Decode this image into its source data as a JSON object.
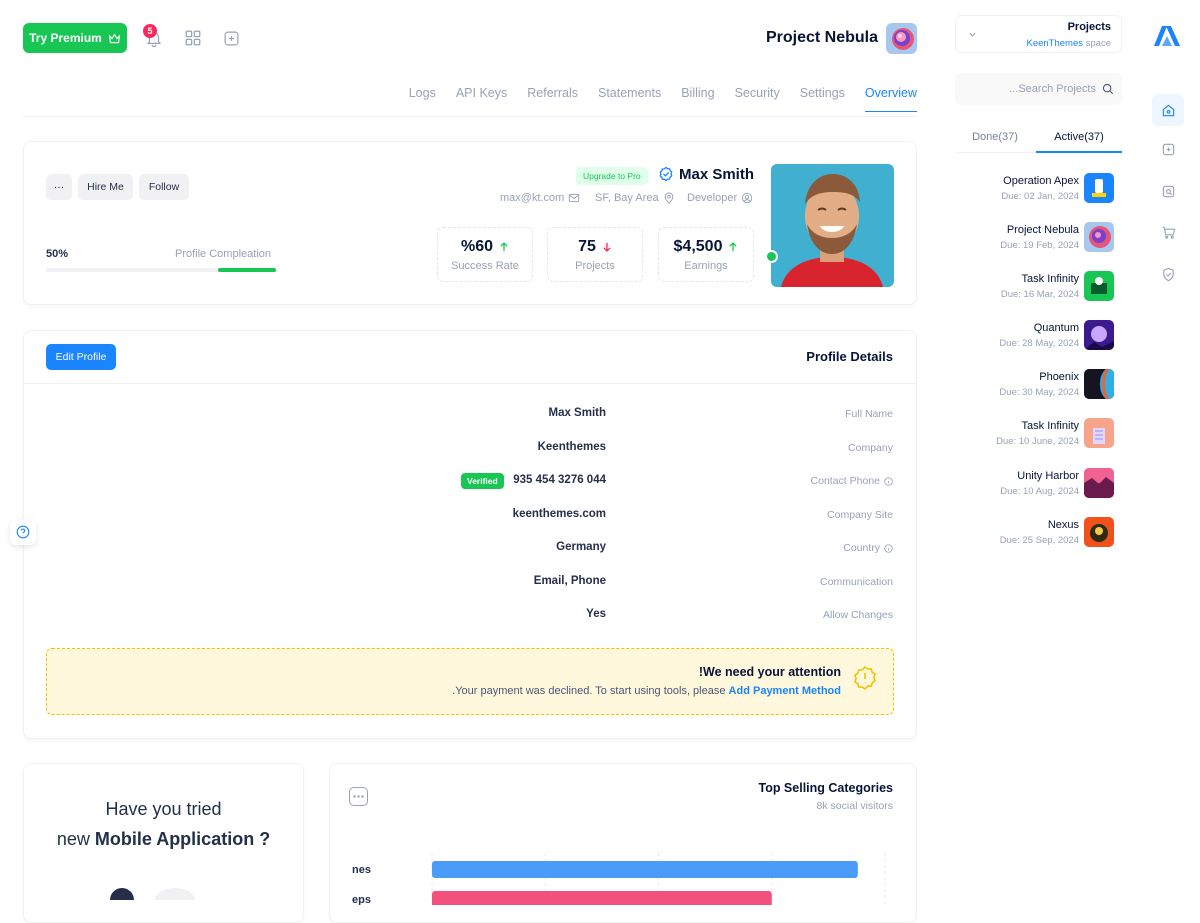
{
  "topbar": {
    "premium_label": "Try Premium",
    "notification_count": "5",
    "project_title": "Project Nebula"
  },
  "tabs": [
    "Logs",
    "API Keys",
    "Referrals",
    "Statements",
    "Billing",
    "Security",
    "Settings",
    "Overview"
  ],
  "profile": {
    "name": "Max Smith",
    "upgrade_badge": "Upgrade to Pro",
    "email": "max@kt.com",
    "location": "SF, Bay Area",
    "role": "Developer",
    "more_label": "···",
    "hire_label": "Hire Me",
    "follow_label": "Follow",
    "completion_percent_label": "50%",
    "completion_value": 0.5,
    "completion_label": "Profile Compleation",
    "stats": [
      {
        "value": "%60",
        "label": "Success Rate",
        "trend": "up"
      },
      {
        "value": "75",
        "label": "Projects",
        "trend": "down"
      },
      {
        "value": "$4,500",
        "label": "Earnings",
        "trend": "up"
      }
    ]
  },
  "details": {
    "edit_label": "Edit Profile",
    "title": "Profile Details",
    "verified_label": "Verified",
    "rows": [
      {
        "value": "Max Smith",
        "label": "Full Name"
      },
      {
        "value": "Keenthemes",
        "label": "Company"
      },
      {
        "value": "935 454 3276 044",
        "label": "Contact Phone"
      },
      {
        "value": "keenthemes.com",
        "label": "Company Site"
      },
      {
        "value": "Germany",
        "label": "Country"
      },
      {
        "value": "Email, Phone",
        "label": "Communication"
      },
      {
        "value": "Yes",
        "label": "Allow Changes"
      }
    ],
    "alert_title": "!We need your attention",
    "alert_text": ".Your payment was declined. To start using tools, please",
    "alert_link": "Add Payment Method"
  },
  "mobile_card": {
    "line1": "Have you tried",
    "line2_prefix": "new",
    "line2_bold": "Mobile Application ?"
  },
  "chart_card": {
    "title": "Top Selling Categories",
    "subtitle": "8k social visitors"
  },
  "chart_data": {
    "type": "bar",
    "orientation": "horizontal",
    "categories": [
      "nes",
      "eps"
    ],
    "values": [
      0.94,
      0.75
    ],
    "colors": [
      "#4b9bf8",
      "#f2517e"
    ]
  },
  "sidebar": {
    "selector_title": "Projects",
    "selector_sub_link": "KeenThemes",
    "selector_sub_text": "space",
    "search_placeholder": "...Search Projects",
    "tab_done": "Done(37)",
    "tab_active": "Active(37)",
    "projects": [
      {
        "name": "Operation Apex",
        "due": "Due: 02 Jan, 2024",
        "color": "#1b84ff"
      },
      {
        "name": "Project Nebula",
        "due": "Due: 19 Feb, 2024",
        "color": "#c98bd8"
      },
      {
        "name": "Task Infinity",
        "due": "Due: 16 Mar, 2024",
        "color": "#17c653"
      },
      {
        "name": "Quantum",
        "due": "Due: 28 May, 2024",
        "color": "#5b2bb5"
      },
      {
        "name": "Phoenix",
        "due": "Due: 30 May, 2024",
        "color": "#151521"
      },
      {
        "name": "Task Infinity",
        "due": "Due: 10 June, 2024",
        "color": "#f7a58a"
      },
      {
        "name": "Unity Harbor",
        "due": "Due: 10 Aug, 2024",
        "color": "#c2185b"
      },
      {
        "name": "Nexus",
        "due": "Due: 25 Sep, 2024",
        "color": "#f1511b"
      }
    ]
  }
}
